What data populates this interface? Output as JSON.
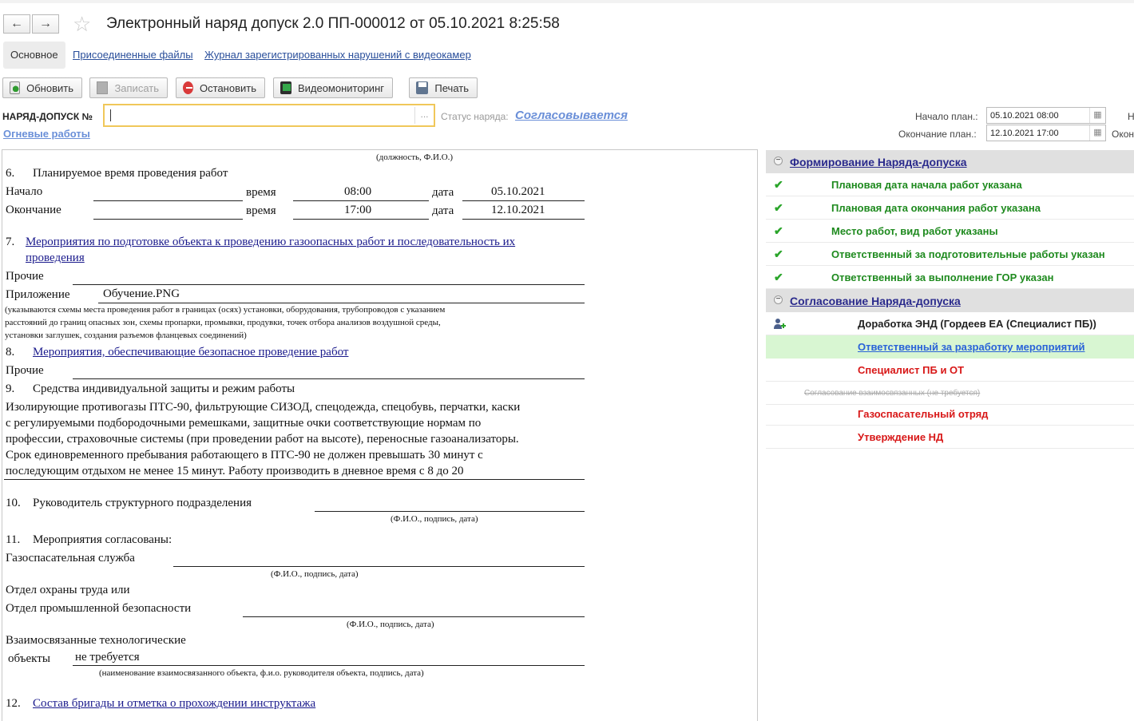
{
  "window": {
    "title": "Электронный наряд допуск 2.0 ПП-000012 от 05.10.2021 8:25:58",
    "back_glyph": "←",
    "forward_glyph": "→",
    "star_glyph": "☆"
  },
  "tabs": [
    {
      "label": "Основное"
    },
    {
      "label": "Присоединенные файлы"
    },
    {
      "label": "Журнал зарегистрированных нарушений с видеокамер"
    }
  ],
  "toolbar": {
    "refresh": "Обновить",
    "save": "Записать",
    "stop": "Остановить",
    "video": "Видеомониторинг",
    "print": "Печать"
  },
  "form": {
    "number_label": "НАРЯД-ДОПУСК №",
    "number_value": "",
    "number_select_glyph": "...",
    "status_label": "Статус наряда:",
    "status_value": "Согласовывается",
    "work_type_link": "Огневые работы",
    "plan_start_label": "Начало план.:",
    "plan_start_value": "05.10.2021 08:00",
    "plan_end_label": "Окончание план.:",
    "plan_end_value": "12.10.2021 17:00",
    "calendar_glyph": "▦",
    "cut_label_1": "Н",
    "cut_label_2": "Окон"
  },
  "document": {
    "position_caption": "(должность,  Ф.И.О.)",
    "s6_num": "6.",
    "s6_title": "Планируемое время проведения работ",
    "start_label": "Начало",
    "end_label": "Окончание",
    "time_label": "время",
    "date_label": "дата",
    "start_time": "08:00",
    "start_date": "05.10.2021",
    "end_time": "17:00",
    "end_date": "12.10.2021",
    "s7_num": "7.",
    "s7_title_1": "Мероприятия по подготовке объекта к проведению газоопасных работ и последовательность их",
    "s7_title_2": "проведения ",
    "other_label": "Прочие",
    "attachment_label": "Приложение",
    "attachment_value": "Обучение.PNG",
    "schemes_note_1": "(указываются схемы места проведения работ в границах (осях) установки, оборудования, трубопроводов с указанием",
    "schemes_note_2": "расстояний до границ опасных зон, схемы пропарки, промывки, продувки, точек отбора анализов воздушной среды,",
    "schemes_note_3": "установки заглушек, создания разъемов фланцевых соединений)",
    "s8_num": "8.",
    "s8_title": "Мероприятия, обеспечивающие безопасное проведение работ",
    "other_label_2": "Прочие",
    "s9_num": "9.",
    "s9_title": "Средства индивидуальной защиты и режим работы",
    "ppe_1": "Изолирующие противогазы ПТС-90, фильтрующие СИЗОД, спецодежда, спецобувь, перчатки, каски",
    "ppe_2": "с регулируемыми подбородочными ремешками, защитные очки соответствующие нормам по",
    "ppe_3": "профессии, страховочные системы (при проведении работ на высоте), переносные газоанализаторы.",
    "ppe_4": "Срок единовременного пребывания работающего в ПТС-90 не должен превышать 30 минут с",
    "ppe_5": "последующим отдыхом не менее 15 минут. Работу производить в дневное время с 8 до 20",
    "s10_num": "10.",
    "s10_title": "Руководитель структурного подразделения",
    "fio_caption": "(Ф.И.О., подпись, дата)",
    "s11_num": "11.",
    "s11_title": "Мероприятия согласованы:",
    "gas_rescue_label": "Газоспасательная служба",
    "labor_label_1": "Отдел охраны труда или",
    "labor_label_2": "Отдел промышленной безопасности",
    "related_label_1": "Взаимосвязанные технологические",
    "related_label_2": "объекты",
    "related_value": "не требуется",
    "related_caption": "(наименование взаимосвязанного объекта, ф.и.о. руководителя объекта, подпись, дата)",
    "s12_num": "12.",
    "s12_title": "Состав бригады и отметка о прохождении инструктажа"
  },
  "workflow": {
    "group1": {
      "toggle": "−",
      "title": "Формирование Наряда-допуска"
    },
    "checks": [
      "Плановая дата начала работ указана",
      "Плановая дата окончания работ указана",
      "Место работ, вид работ указаны",
      "Ответственный за подготовительные работы указан",
      "Ответственный за выполнение ГОР указан"
    ],
    "check_glyph": "✔",
    "group2": {
      "toggle": "−",
      "title": "Согласование Наряда-допуска"
    },
    "steps": {
      "revision": "Доработка ЭНД (Гордеев ЕА (Специалист ПБ))",
      "responsible": "Ответственный за разработку мероприятий",
      "specialist": "Специалист ПБ и ОТ",
      "related_skip": "Согласование взаимосвязанных (не требуется)",
      "gas_rescue": "Газоспасательный отряд",
      "approval": "Утверждение НД"
    }
  }
}
